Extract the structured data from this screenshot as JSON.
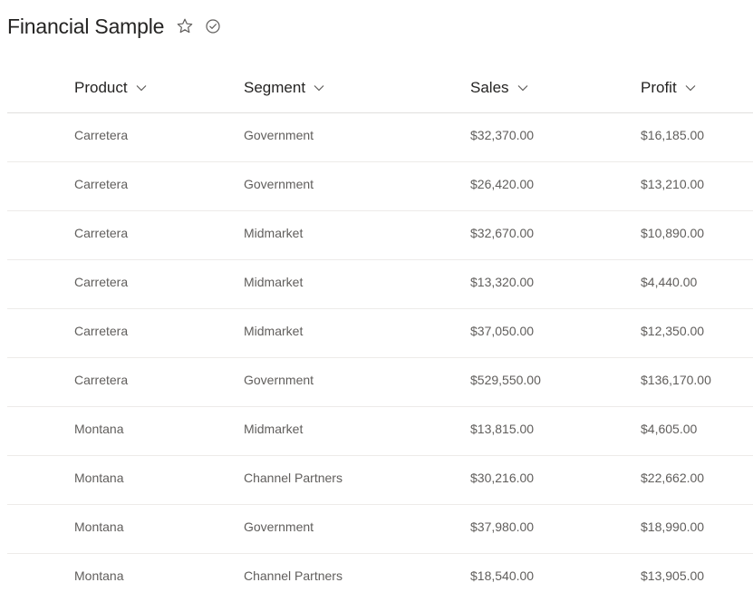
{
  "page": {
    "title": "Financial Sample",
    "favorite_icon": "star-outline-icon",
    "status_icon": "check-circle-icon"
  },
  "columns": [
    {
      "label": "Product",
      "icon": "chevron-down-icon"
    },
    {
      "label": "Segment",
      "icon": "chevron-down-icon"
    },
    {
      "label": "Sales",
      "icon": "chevron-down-icon"
    },
    {
      "label": "Profit",
      "icon": "chevron-down-icon"
    }
  ],
  "rows": [
    {
      "product": "Carretera",
      "segment": "Government",
      "sales": "$32,370.00",
      "profit": "$16,185.00"
    },
    {
      "product": "Carretera",
      "segment": "Government",
      "sales": "$26,420.00",
      "profit": "$13,210.00"
    },
    {
      "product": "Carretera",
      "segment": "Midmarket",
      "sales": "$32,670.00",
      "profit": "$10,890.00"
    },
    {
      "product": "Carretera",
      "segment": "Midmarket",
      "sales": "$13,320.00",
      "profit": "$4,440.00"
    },
    {
      "product": "Carretera",
      "segment": "Midmarket",
      "sales": "$37,050.00",
      "profit": "$12,350.00"
    },
    {
      "product": "Carretera",
      "segment": "Government",
      "sales": "$529,550.00",
      "profit": "$136,170.00"
    },
    {
      "product": "Montana",
      "segment": "Midmarket",
      "sales": "$13,815.00",
      "profit": "$4,605.00"
    },
    {
      "product": "Montana",
      "segment": "Channel Partners",
      "sales": "$30,216.00",
      "profit": "$22,662.00"
    },
    {
      "product": "Montana",
      "segment": "Government",
      "sales": "$37,980.00",
      "profit": "$18,990.00"
    },
    {
      "product": "Montana",
      "segment": "Channel Partners",
      "sales": "$18,540.00",
      "profit": "$13,905.00"
    }
  ],
  "colors": {
    "title_text": "#252423",
    "cell_text": "#605e5c",
    "divider": "#edebe9"
  }
}
